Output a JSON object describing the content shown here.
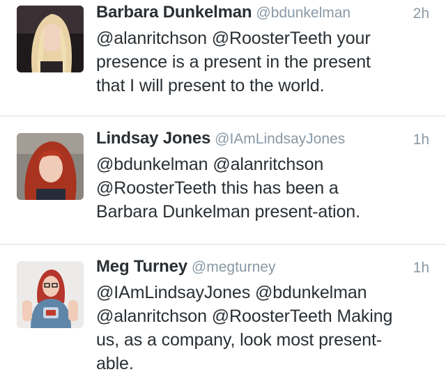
{
  "tweets": [
    {
      "name": "Barbara Dunkelman",
      "handle": "@bdunkelman",
      "time": "2h",
      "lines": [
        "@alanritchson @RoosterTeeth your",
        "presence is a present in the present",
        "that I will present to the world."
      ]
    },
    {
      "name": "Lindsay Jones",
      "handle": "@IAmLindsayJones",
      "time": "1h",
      "lines": [
        "@bdunkelman @alanritchson",
        "@RoosterTeeth this has been a",
        "Barbara Dunkelman present-ation."
      ]
    },
    {
      "name": "Meg Turney",
      "handle": "@megturney",
      "time": "1h",
      "lines": [
        "@IAmLindsayJones @bdunkelman",
        "@alanritchson @RoosterTeeth Making",
        "us, as a company, look most present-",
        "able."
      ]
    }
  ],
  "colors": {
    "name": "#292f33",
    "meta": "#8899a6",
    "divider": "#d8dcdf"
  }
}
